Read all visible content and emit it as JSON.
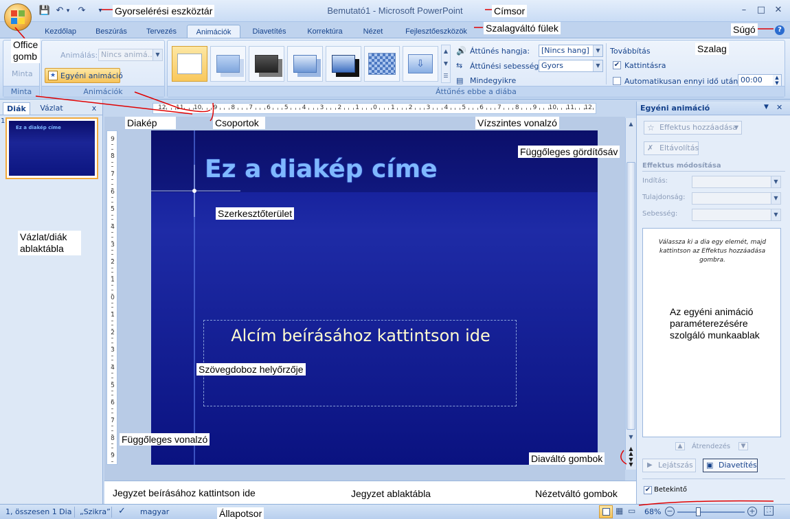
{
  "window": {
    "title": "Bemutató1 - Microsoft PowerPoint",
    "minimize": "–",
    "maximize": "□",
    "close": "✕"
  },
  "qat": {
    "save": "💾",
    "undo": "↶",
    "undo_drop": "▾",
    "redo": "↷",
    "customize": "▾"
  },
  "tabs": [
    "Kezdőlap",
    "Beszúrás",
    "Tervezés",
    "Animációk",
    "Diavetítés",
    "Korrektúra",
    "Nézet",
    "Fejlesztőeszközök"
  ],
  "active_tab": "Animációk",
  "help_icon": "?",
  "ribbon": {
    "minta": {
      "label": "Minta",
      "button": "Minta"
    },
    "animaciok": {
      "label": "Animációk",
      "animalas_label": "Animálás:",
      "animalas_value": "Nincs animá...",
      "custom_button": "Egyéni animáció"
    },
    "attunes": {
      "label": "Áttűnés ebbe a diába",
      "hang_label": "Áttűnés hangja:",
      "hang_value": "[Nincs hang]",
      "sebesseg_label": "Áttűnési sebesség:",
      "sebesseg_value": "Gyors",
      "mindegyikre": "Mindegyikre",
      "tovabbitas": "Továbbítás",
      "kattintasra": "Kattintásra",
      "kattintasra_checked": true,
      "automatikusan": "Automatikusan ennyi idő után:",
      "automatikusan_checked": false,
      "time_value": "00:00"
    }
  },
  "left_pane": {
    "tab_slides": "Diák",
    "tab_outline": "Vázlat",
    "close": "x",
    "slide_number": "1",
    "thumb_title": "Ez a diakép címe"
  },
  "hruler_labels": [
    "12",
    "11",
    "10",
    "9",
    "8",
    "7",
    "6",
    "5",
    "4",
    "3",
    "2",
    "1",
    "0",
    "1",
    "2",
    "3",
    "4",
    "5",
    "6",
    "7",
    "8",
    "9",
    "10",
    "11",
    "12"
  ],
  "vruler_labels": [
    "9",
    "8",
    "7",
    "6",
    "5",
    "4",
    "3",
    "2",
    "1",
    "0",
    "1",
    "2",
    "3",
    "4",
    "5",
    "6",
    "7",
    "8",
    "9"
  ],
  "slide": {
    "title": "Ez a diakép címe",
    "subtitle": "Alcím beírásához kattintson ide"
  },
  "notes": {
    "placeholder": "Jegyzet beírásához kattintson ide"
  },
  "task_pane": {
    "title": "Egyéni animáció",
    "add_effect": "Effektus hozzáadása",
    "remove": "Eltávolítás",
    "modify_header": "Effektus módosítása",
    "start_label": "Indítás:",
    "property_label": "Tulajdonság:",
    "speed_label": "Sebesség:",
    "hint": "Válassza ki a dia egy elemét, majd kattintson az Effektus hozzáadása gombra.",
    "reorder": "Átrendezés",
    "play": "Lejátszás",
    "slideshow": "Diavetítés",
    "preview": "Betekintő",
    "preview_checked": true
  },
  "status_bar": {
    "slide_info": "1, összesen 1 Dia",
    "theme": "„Szikra”",
    "language": "magyar",
    "zoom": "68%"
  },
  "callouts": {
    "office_button": "Office\ngomb",
    "qat": "Gyorselérési eszköztár",
    "title_bar": "Címsor",
    "ribbon_tabs": "Szalagváltó fülek",
    "help": "Súgó",
    "ribbon": "Szalag",
    "slide_callout": "Diakép",
    "groups": "Csoportok",
    "hruler": "Vízszintes vonalzó",
    "vscroll": "Függőleges gördítősáv",
    "editing_area": "Szerkesztőterület",
    "outline_pane": "Vázlat/diák\nablaktábla",
    "textbox_placeholder": "Szövegdoboz helyőrzője",
    "task_pane": "Az egyéni animáció\nparaméterezésére\nszolgáló munkaablak",
    "vruler": "Függőleges vonalzó",
    "slide_nav": "Diaváltó gombok",
    "notes_pane": "Jegyzet ablaktábla",
    "view_buttons": "Nézetváltó gombok",
    "status_bar": "Állapotsor"
  },
  "colors": {
    "accent": "#15428b",
    "slide_bg": "#0d1590",
    "slide_title": "#7fb8ff",
    "slide_subtitle": "#fffbd0",
    "callout_line": "#e00000"
  }
}
